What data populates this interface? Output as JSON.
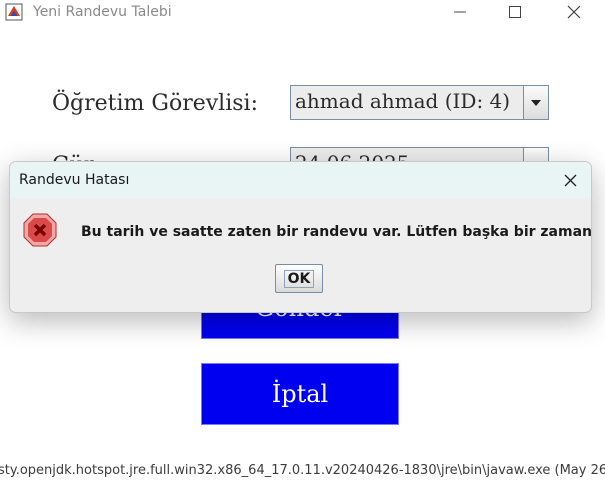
{
  "window": {
    "title": "Yeni Randevu Talebi",
    "app_icon": "java-app-icon",
    "controls": [
      "minimize-icon",
      "maximize-icon",
      "close-icon"
    ]
  },
  "form": {
    "instructor_label": "Öğretim Görevlisi:",
    "instructor_value": "ahmad ahmad (ID: 4)",
    "date_label": "Gün:",
    "date_value": "24.06.2025",
    "submit_label": "Gönder",
    "cancel_label": "İptal"
  },
  "status_text": "sty.openjdk.hotspot.jre.full.win32.x86_64_17.0.11.v20240426-1830\\jre\\bin\\javaw.exe  (May 26",
  "dialog": {
    "title": "Randevu Hatası",
    "message": "Bu tarih ve saatte zaten bir randevu var. Lütfen başka bir zaman seçin.",
    "ok_label": "OK",
    "icon": "error-icon"
  },
  "colors": {
    "button_blue": "#0000f0",
    "dialog_title_bg": "#e9f4f5",
    "error_red": "#c0392b"
  }
}
